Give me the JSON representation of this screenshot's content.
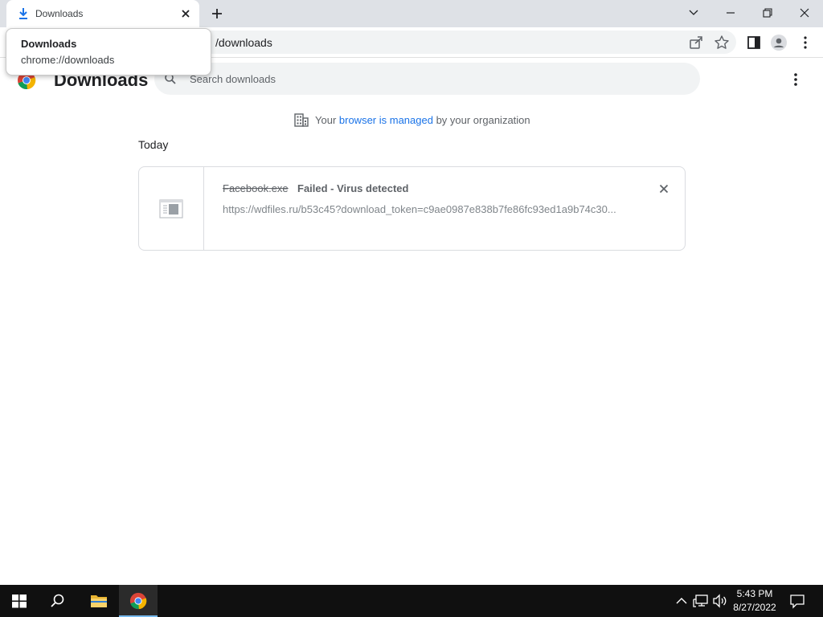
{
  "browser": {
    "tab": {
      "title": "Downloads"
    },
    "omnibox": {
      "url_visible": "/downloads"
    },
    "tooltip": {
      "title": "Downloads",
      "url": "chrome://downloads"
    }
  },
  "page": {
    "title": "Downloads",
    "search": {
      "placeholder": "Search downloads"
    },
    "managed": {
      "prefix": "Your ",
      "link": "browser is managed",
      "suffix": " by your organization"
    },
    "section_date": "Today",
    "downloads": [
      {
        "file_name": "Facebook.exe",
        "status": "Failed - Virus detected",
        "url": "https://wdfiles.ru/b53c45?download_token=c9ae0987e838b7fe86fc93ed1a9b74c30..."
      }
    ]
  },
  "taskbar": {
    "time": "5:43 PM",
    "date": "8/27/2022"
  },
  "colors": {
    "accent_link": "#1a73e8",
    "tabstrip": "#dee1e6",
    "taskbar": "#101010"
  }
}
